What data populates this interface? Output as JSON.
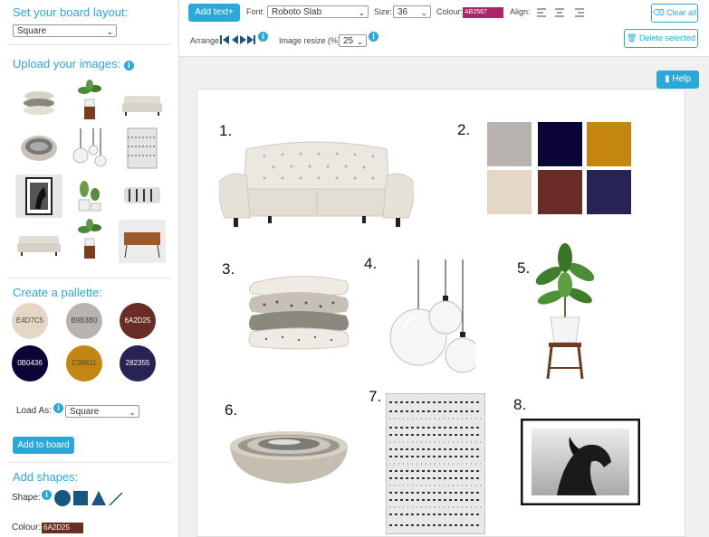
{
  "sidebar": {
    "layout_title": "Set your board layout:",
    "layout_value": "Square",
    "upload_title": "Upload your images:",
    "palette_title": "Create a pallette:",
    "swatches": [
      {
        "hex": "E4D7C5",
        "color": "#E4D7C5",
        "text_color": "#444444"
      },
      {
        "hex": "B9B3B0",
        "color": "#B9B3B0",
        "text_color": "#444444"
      },
      {
        "hex": "6A2D25",
        "color": "#6A2D25",
        "text_color": "#FFFFFF"
      },
      {
        "hex": "0B0436",
        "color": "#0B0436",
        "text_color": "#FFFFFF"
      },
      {
        "hex": "C38611",
        "color": "#C38611",
        "text_color": "#444444"
      },
      {
        "hex": "282355",
        "color": "#282355",
        "text_color": "#FFFFFF"
      }
    ],
    "load_as_label": "Load As:",
    "load_as_value": "Square",
    "add_to_board": "Add to board",
    "shapes_title": "Add shapes:",
    "shape_label": "Shape:",
    "colour_label": "Colour:",
    "colour_value": "6A2D25",
    "colour_hex": "#6A2D25"
  },
  "toolbar": {
    "add_text": "Add text+",
    "font_label": "Font:",
    "font_value": "Roboto Slab",
    "size_label": "Size:",
    "size_value": "36",
    "colour_label": "Colour:",
    "colour_value": "AB2567",
    "colour_hex": "#AB2567",
    "align_label": "Align:",
    "clear_all": "Clear all",
    "arrange_label": "Arrange:",
    "resize_label": "Image resize (%):",
    "resize_value": "25",
    "delete_selected": "Delete selected"
  },
  "help": "Help",
  "board": {
    "numbers": [
      "1.",
      "2.",
      "3.",
      "4.",
      "5.",
      "6.",
      "7.",
      "8."
    ],
    "palette_colors": [
      "#B9B3B0",
      "#0B0436",
      "#C38611",
      "#E4D7C5",
      "#6A2D25",
      "#282355"
    ]
  }
}
